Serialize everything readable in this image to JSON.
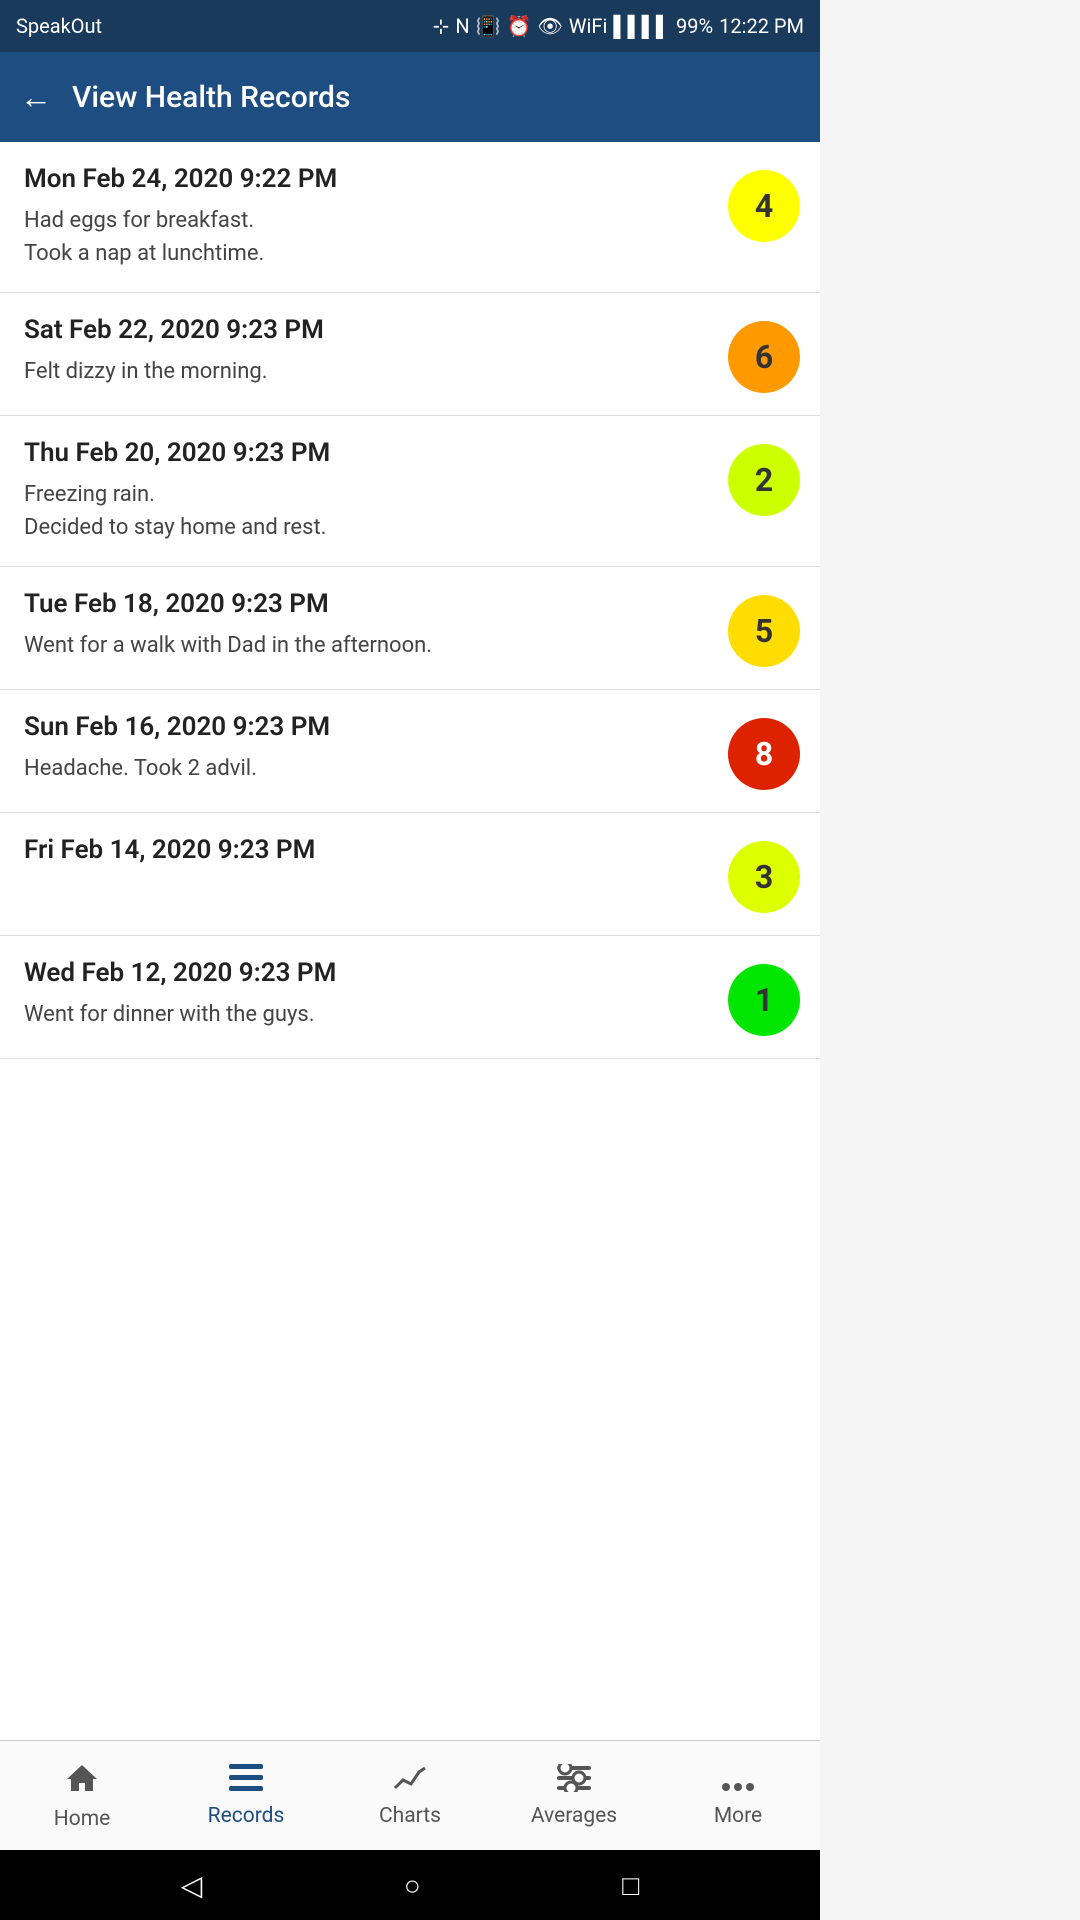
{
  "statusBar": {
    "carrier": "SpeakOut",
    "time": "12:22 PM",
    "battery": "99%"
  },
  "header": {
    "title": "View Health Records",
    "backLabel": "←"
  },
  "records": [
    {
      "date": "Mon Feb 24, 2020 9:22 PM",
      "notes": "Had eggs for breakfast.\nTook a nap at lunchtime.",
      "score": 4,
      "scoreClass": "score-4"
    },
    {
      "date": "Sat Feb 22, 2020 9:23 PM",
      "notes": "Felt dizzy in the morning.",
      "score": 6,
      "scoreClass": "score-6"
    },
    {
      "date": "Thu Feb 20, 2020 9:23 PM",
      "notes": "Freezing rain.\nDecided to stay home and rest.",
      "score": 2,
      "scoreClass": "score-2"
    },
    {
      "date": "Tue Feb 18, 2020 9:23 PM",
      "notes": "Went for a walk with Dad in the afternoon.",
      "score": 5,
      "scoreClass": "score-5"
    },
    {
      "date": "Sun Feb 16, 2020 9:23 PM",
      "notes": "Headache.  Took 2 advil.",
      "score": 8,
      "scoreClass": "score-8"
    },
    {
      "date": "Fri Feb 14, 2020 9:23 PM",
      "notes": "",
      "score": 3,
      "scoreClass": "score-3"
    },
    {
      "date": "Wed Feb 12, 2020 9:23 PM",
      "notes": "Went for dinner with the guys.",
      "score": 1,
      "scoreClass": "score-1"
    }
  ],
  "bottomNav": {
    "items": [
      {
        "label": "Home",
        "icon": "⌂",
        "active": false
      },
      {
        "label": "Records",
        "icon": "☰",
        "active": true
      },
      {
        "label": "Charts",
        "icon": "↗",
        "active": false
      },
      {
        "label": "Averages",
        "icon": "⊞",
        "active": false
      },
      {
        "label": "More",
        "icon": "•••",
        "active": false
      }
    ]
  }
}
